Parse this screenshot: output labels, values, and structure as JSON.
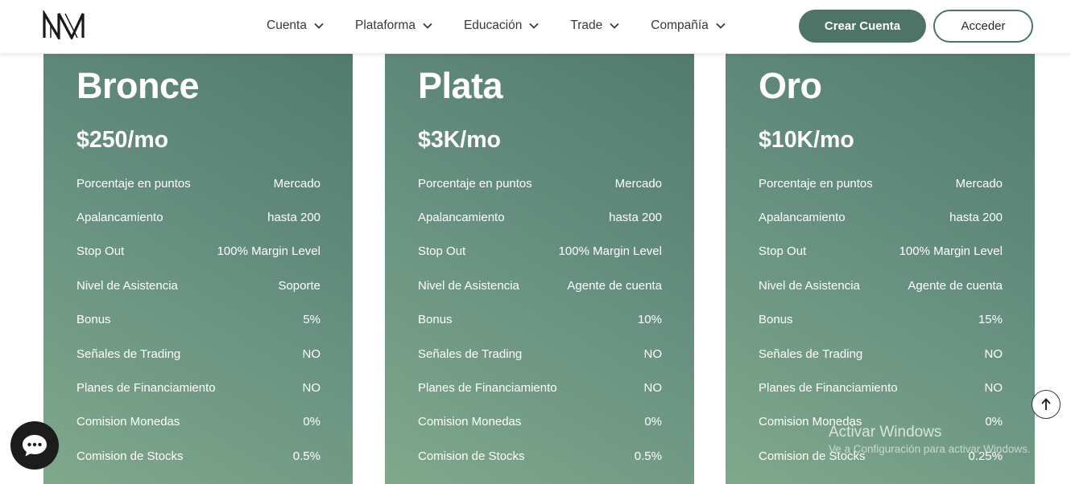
{
  "header": {
    "logo_icon": "nm-monogram-logo",
    "nav": [
      {
        "label": "Cuenta",
        "icon": "chevron-down-icon"
      },
      {
        "label": "Plataforma",
        "icon": "chevron-down-icon"
      },
      {
        "label": "Educación",
        "icon": "chevron-down-icon"
      },
      {
        "label": "Trade",
        "icon": "chevron-down-icon"
      },
      {
        "label": "Compañía",
        "icon": "chevron-down-icon"
      }
    ],
    "create_account_label": "Crear Cuenta",
    "login_label": "Acceder"
  },
  "colors": {
    "accent": "#4e7468",
    "card_gradient_light": "#80a88b",
    "card_gradient_dark": "#527a6e",
    "text_dark": "#333a40"
  },
  "plans": [
    {
      "name": "Bronce",
      "price": "$250/mo",
      "features": [
        {
          "label": "Porcentaje en puntos",
          "value": "Mercado"
        },
        {
          "label": "Apalancamiento",
          "value": "hasta 200"
        },
        {
          "label": "Stop Out",
          "value": "100% Margin Level"
        },
        {
          "label": "Nivel de Asistencia",
          "value": "Soporte"
        },
        {
          "label": "Bonus",
          "value": "5%"
        },
        {
          "label": "Señales de Trading",
          "value": "NO"
        },
        {
          "label": "Planes de Financiamiento",
          "value": "NO"
        },
        {
          "label": "Comision Monedas",
          "value": "0%"
        },
        {
          "label": "Comision de Stocks",
          "value": "0.5%"
        }
      ]
    },
    {
      "name": "Plata",
      "price": "$3K/mo",
      "features": [
        {
          "label": "Porcentaje en puntos",
          "value": "Mercado"
        },
        {
          "label": "Apalancamiento",
          "value": "hasta 200"
        },
        {
          "label": "Stop Out",
          "value": "100% Margin Level"
        },
        {
          "label": "Nivel de Asistencia",
          "value": "Agente de cuenta"
        },
        {
          "label": "Bonus",
          "value": "10%"
        },
        {
          "label": "Señales de Trading",
          "value": "NO"
        },
        {
          "label": "Planes de Financiamiento",
          "value": "NO"
        },
        {
          "label": "Comision Monedas",
          "value": "0%"
        },
        {
          "label": "Comision de Stocks",
          "value": "0.5%"
        }
      ]
    },
    {
      "name": "Oro",
      "price": "$10K/mo",
      "features": [
        {
          "label": "Porcentaje en puntos",
          "value": "Mercado"
        },
        {
          "label": "Apalancamiento",
          "value": "hasta 200"
        },
        {
          "label": "Stop Out",
          "value": "100% Margin Level"
        },
        {
          "label": "Nivel de Asistencia",
          "value": "Agente de cuenta"
        },
        {
          "label": "Bonus",
          "value": "15%"
        },
        {
          "label": "Señales de Trading",
          "value": "NO"
        },
        {
          "label": "Planes de Financiamiento",
          "value": "NO"
        },
        {
          "label": "Comision Monedas",
          "value": "0%"
        },
        {
          "label": "Comision de Stocks",
          "value": "0.25%"
        }
      ]
    }
  ],
  "widgets": {
    "chat_icon": "chat-bubble-icon",
    "scroll_top_icon": "arrow-up-icon"
  },
  "watermark": {
    "title": "Activar Windows",
    "subtitle": "Ve a Configuración para activar Windows."
  }
}
